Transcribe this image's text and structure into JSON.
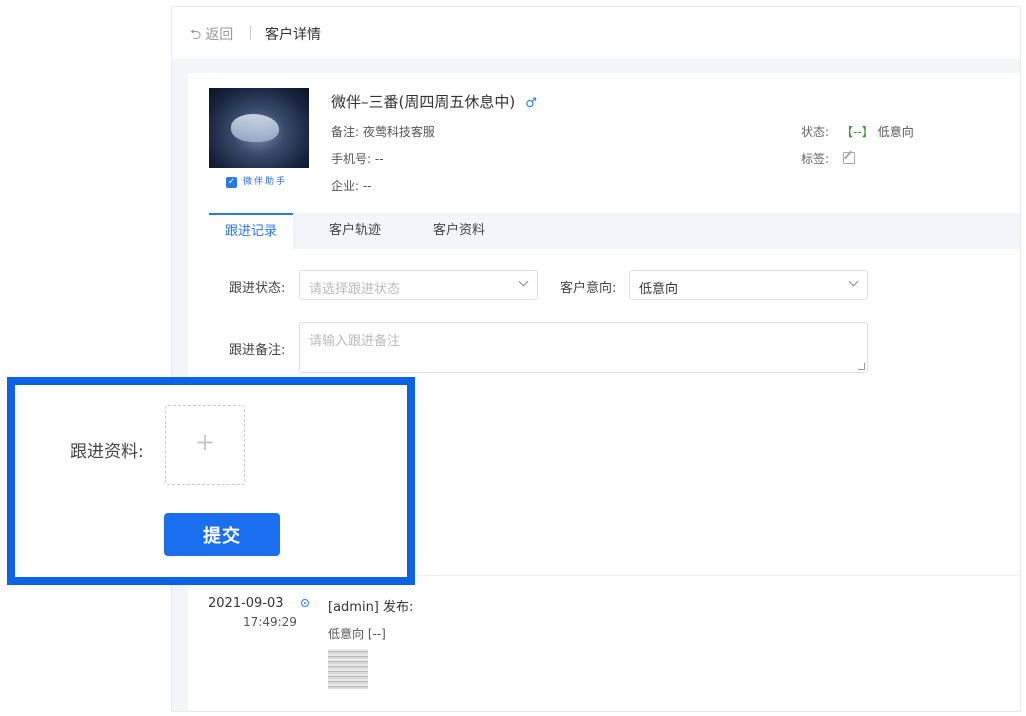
{
  "header": {
    "back_label": "返回",
    "crumb": "客户详情"
  },
  "customer": {
    "name": "微伴–三番(周四周五休息中)",
    "gender_icon": "male-icon",
    "remark_label": "备注:",
    "remark": "夜莺科技客服",
    "phone_label": "手机号:",
    "phone": "--",
    "company_label": "企业:",
    "company": "--",
    "status_label": "状态:",
    "status_tag": "【--】",
    "status_value": "低意向",
    "tags_label": "标签:",
    "brand": "微伴助手"
  },
  "tabs": [
    "跟进记录",
    "客户轨迹",
    "客户资料"
  ],
  "form": {
    "follow_status_label": "跟进状态:",
    "follow_status_placeholder": "请选择跟进状态",
    "intent_label": "客户意向:",
    "intent_value": "低意向",
    "remark_label": "跟进备注:",
    "remark_placeholder": "请输入跟进备注"
  },
  "popup": {
    "material_label": "跟进资料:",
    "upload_plus": "+",
    "submit_label": "提交"
  },
  "timeline": [
    {
      "date": "2021-09-03",
      "time": "17:49:29",
      "title": "[admin] 发布:",
      "content": "低意向 [--]"
    }
  ],
  "colors": {
    "accent": "#2a79e8",
    "status_green": "#3a9a2e",
    "highlight_border": "#0b63e6"
  }
}
